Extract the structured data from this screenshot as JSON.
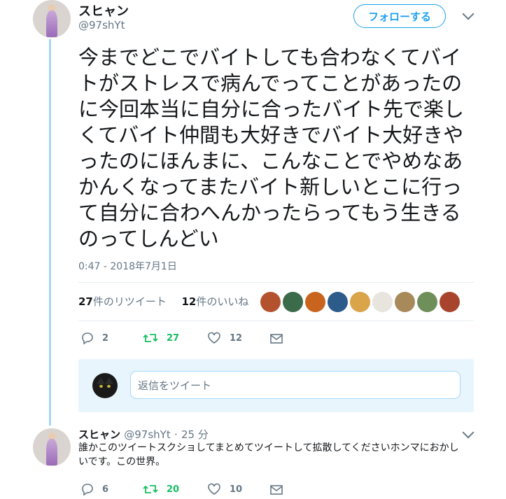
{
  "tweet": {
    "display_name": "スヒャン",
    "handle": "@97shYt",
    "follow_label": "フォローする",
    "text": "今までどこでバイトしても合わなくてバイトがストレスで病んでってことがあったのに今回本当に自分に合ったバイト先で楽しくてバイト仲間も大好きでバイト大好きやったのにほんまに、こんなことでやめなあかんくなってまたバイト新しいとこに行って自分に合わへんかったらってもう生きるのってしんどい",
    "timestamp": "0:47 - 2018年7月1日",
    "retweet_count": "27",
    "retweet_label": "件のリツイート",
    "like_count": "12",
    "like_label": "件のいいね",
    "actions": {
      "replies": "2",
      "retweets": "27",
      "likes": "12"
    },
    "likers": [
      {
        "icon": "liker-avatar",
        "color": "#b5522e"
      },
      {
        "icon": "liker-avatar",
        "color": "#3b6b4a"
      },
      {
        "icon": "liker-avatar",
        "color": "#c8641e"
      },
      {
        "icon": "liker-avatar",
        "color": "#2d5c8a"
      },
      {
        "icon": "liker-avatar",
        "color": "#d9a44a"
      },
      {
        "icon": "liker-avatar",
        "color": "#e8e4de"
      },
      {
        "icon": "liker-avatar",
        "color": "#a88a5a"
      },
      {
        "icon": "liker-avatar",
        "color": "#6f8f5a"
      },
      {
        "icon": "liker-avatar",
        "color": "#a8442e"
      }
    ]
  },
  "reply_composer": {
    "placeholder": "返信をツイート"
  },
  "reply": {
    "display_name": "スヒャン",
    "handle": "@97shYt",
    "separator": "·",
    "time": "25 分",
    "text": "誰かこのツイートスクショしてまとめてツイートして拡散してくださいホンマにおかしいです。この世界。",
    "actions": {
      "replies": "6",
      "retweets": "20",
      "likes": "10"
    }
  },
  "colors": {
    "accent": "#1da1f2",
    "retweet": "#17bf63",
    "muted": "#657786",
    "thread_line": "#a6d6f5"
  }
}
